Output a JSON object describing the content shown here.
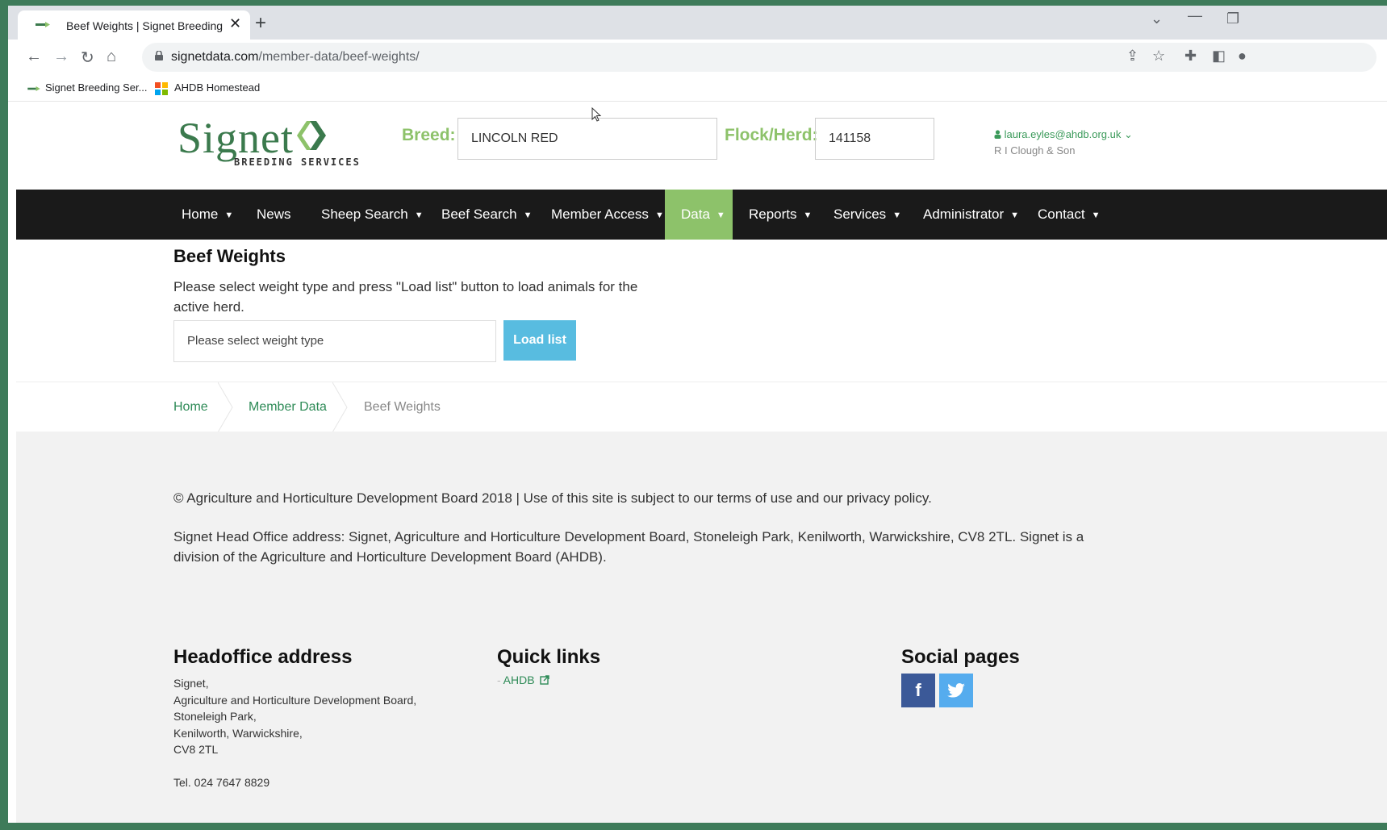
{
  "browser": {
    "tab_title": "Beef Weights | Signet Breeding",
    "tab_close": "✕",
    "new_tab": "+",
    "url_domain": "signetdata.com",
    "url_path": "/member-data/beef-weights/",
    "bookmarks": [
      {
        "label": "Signet Breeding Ser..."
      },
      {
        "label": "AHDB Homestead"
      }
    ]
  },
  "header": {
    "logo_text": "Signet",
    "logo_subtext": "BREEDING SERVICES",
    "breed_label": "Breed:",
    "breed_value": "LINCOLN RED",
    "flock_label": "Flock/Herd:",
    "flock_value": "141158",
    "user_email": "laura.eyles@ahdb.org.uk",
    "user_org": "R I Clough & Son"
  },
  "nav": {
    "items": [
      {
        "label": "Home"
      },
      {
        "label": "News"
      },
      {
        "label": "Sheep Search"
      },
      {
        "label": "Beef Search"
      },
      {
        "label": "Member Access"
      },
      {
        "label": "Data"
      },
      {
        "label": "Reports"
      },
      {
        "label": "Services"
      },
      {
        "label": "Administrator"
      },
      {
        "label": "Contact"
      }
    ]
  },
  "main": {
    "title": "Beef Weights",
    "intro": "Please select weight type and press \"Load list\" button to load animals for the active herd.",
    "select_placeholder": "Please select weight type",
    "load_button": "Load list"
  },
  "breadcrumb": {
    "items": [
      "Home",
      "Member Data",
      "Beef Weights"
    ]
  },
  "footer": {
    "copyright": "© Agriculture and Horticulture Development Board 2018 | Use of this site is subject to our terms of use and our privacy policy.",
    "address_note": "Signet Head Office address: Signet, Agriculture and Horticulture Development Board, Stoneleigh Park, Kenilworth, Warwickshire, CV8 2TL. Signet is a division of the Agriculture and Horticulture Development Board (AHDB).",
    "headoffice_title": "Headoffice address",
    "headoffice_lines": "Signet,\nAgriculture and Horticulture Development Board,\nStoneleigh Park,\nKenilworth, Warwickshire,\nCV8 2TL\n\nTel. 024 7647 8829",
    "quicklinks_title": "Quick links",
    "quicklink_ahdb": "AHDB",
    "social_title": "Social pages",
    "facebook_glyph": "f"
  },
  "colors": {
    "accent_green": "#8dc26a",
    "brand_green": "#3b7a4d",
    "button_blue": "#58bce0",
    "nav_bg": "#1a1a1a",
    "facebook": "#3b5998",
    "twitter": "#55acee"
  }
}
